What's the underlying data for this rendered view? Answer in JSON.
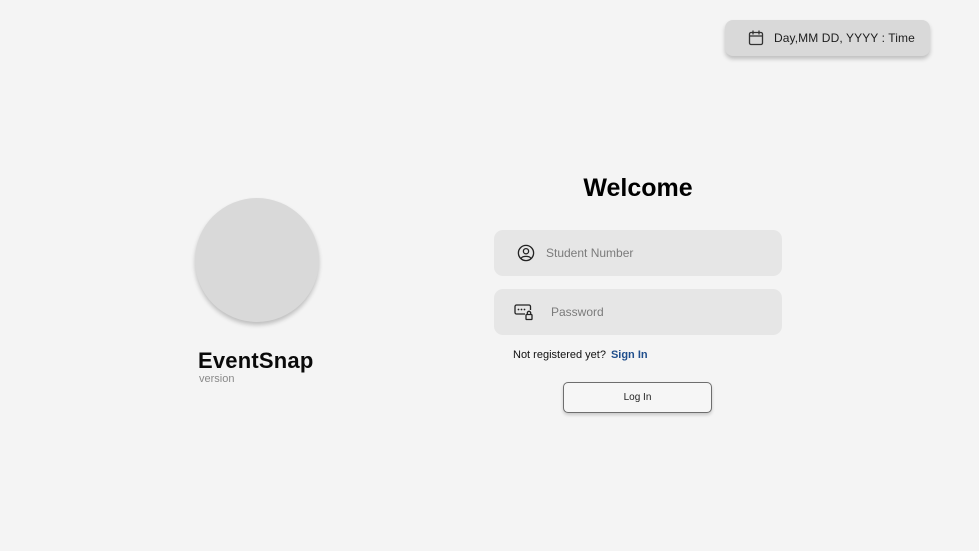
{
  "header": {
    "datetime": "Day,MM DD, YYYY : Time",
    "datetime_icon": "calendar-icon"
  },
  "branding": {
    "app_name": "EventSnap",
    "version_label": "version"
  },
  "login": {
    "title": "Welcome",
    "student_number": {
      "placeholder": "Student Number",
      "value": "",
      "icon": "user-circle-icon"
    },
    "password": {
      "placeholder": "Password",
      "value": "",
      "icon": "password-lock-icon"
    },
    "register_prompt": "Not registered yet?",
    "sign_in_link": "Sign In",
    "login_button": "Log In"
  },
  "colors": {
    "background": "#f4f4f4",
    "field_background": "#e6e6e6",
    "chip_background": "#d9d9d9",
    "link": "#1f4e8c"
  }
}
